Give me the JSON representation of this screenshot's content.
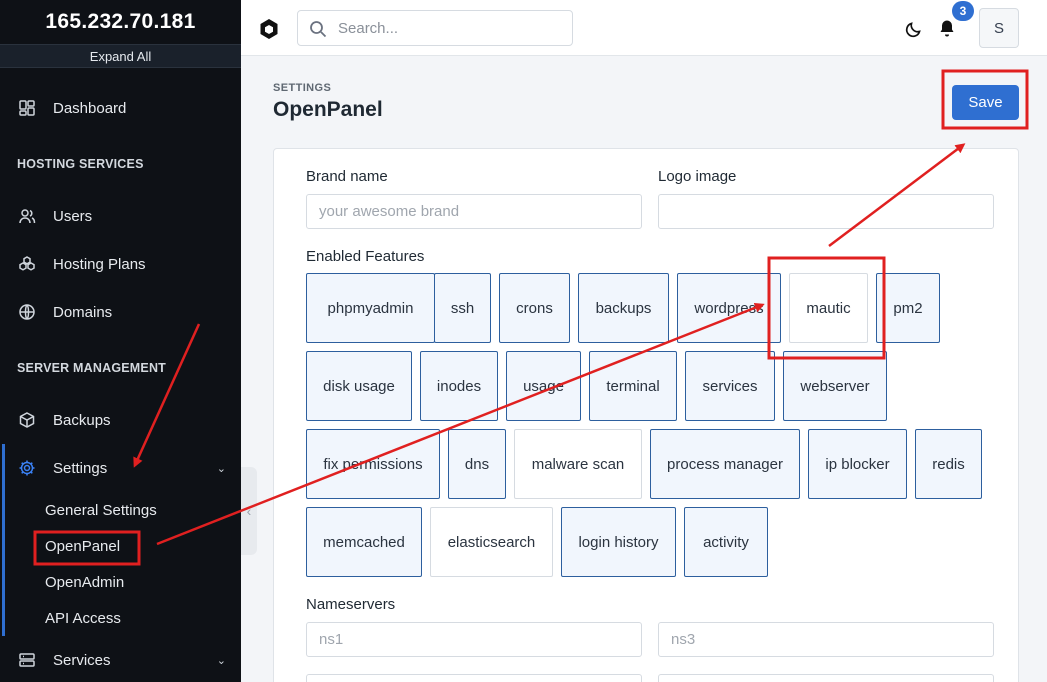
{
  "sidebar": {
    "server_ip": "165.232.70.181",
    "expand_label": "Expand All",
    "dashboard": {
      "label": "Dashboard",
      "icon": "dashboard-icon"
    },
    "hosting_section": "HOSTING SERVICES",
    "users": {
      "label": "Users",
      "icon": "users-icon"
    },
    "hosting_plans": {
      "label": "Hosting Plans",
      "icon": "hosting-plans-icon"
    },
    "domains": {
      "label": "Domains",
      "icon": "www-icon"
    },
    "server_section": "SERVER MANAGEMENT",
    "backups": {
      "label": "Backups",
      "icon": "box-icon"
    },
    "settings": {
      "label": "Settings",
      "icon": "gear-icon"
    },
    "settings_sub": [
      "General Settings",
      "OpenPanel",
      "OpenAdmin",
      "API Access"
    ],
    "services": {
      "label": "Services",
      "icon": "server-icon"
    }
  },
  "topbar": {
    "search_placeholder": "Search...",
    "notification_count": "3",
    "avatar_initial": "S"
  },
  "page": {
    "breadcrumb": "SETTINGS",
    "title": "OpenPanel",
    "save_label": "Save"
  },
  "form": {
    "brand_name_label": "Brand name",
    "brand_name_placeholder": "your awesome brand",
    "logo_image_label": "Logo image",
    "features_label": "Enabled Features",
    "features": [
      {
        "name": "phpmyadmin",
        "enabled": true
      },
      {
        "name": "ssh",
        "enabled": true
      },
      {
        "name": "crons",
        "enabled": true
      },
      {
        "name": "backups",
        "enabled": true
      },
      {
        "name": "wordpress",
        "enabled": true
      },
      {
        "name": "mautic",
        "enabled": false
      },
      {
        "name": "pm2",
        "enabled": true
      },
      {
        "name": "disk usage",
        "enabled": true
      },
      {
        "name": "inodes",
        "enabled": true
      },
      {
        "name": "usage",
        "enabled": true
      },
      {
        "name": "terminal",
        "enabled": true
      },
      {
        "name": "services",
        "enabled": true
      },
      {
        "name": "webserver",
        "enabled": true
      },
      {
        "name": "fix permissions",
        "enabled": true
      },
      {
        "name": "dns",
        "enabled": true
      },
      {
        "name": "malware scan",
        "enabled": false
      },
      {
        "name": "process manager",
        "enabled": true
      },
      {
        "name": "ip blocker",
        "enabled": true
      },
      {
        "name": "redis",
        "enabled": true
      },
      {
        "name": "memcached",
        "enabled": true
      },
      {
        "name": "elasticsearch",
        "enabled": false
      },
      {
        "name": "login history",
        "enabled": true
      },
      {
        "name": "activity",
        "enabled": true
      }
    ],
    "nameservers_label": "Nameservers",
    "ns1_placeholder": "ns1",
    "ns3_placeholder": "ns3"
  },
  "colors": {
    "accent": "#2f6fd1",
    "sidebar_bg": "#0e1116",
    "annotation": "#e02020"
  }
}
